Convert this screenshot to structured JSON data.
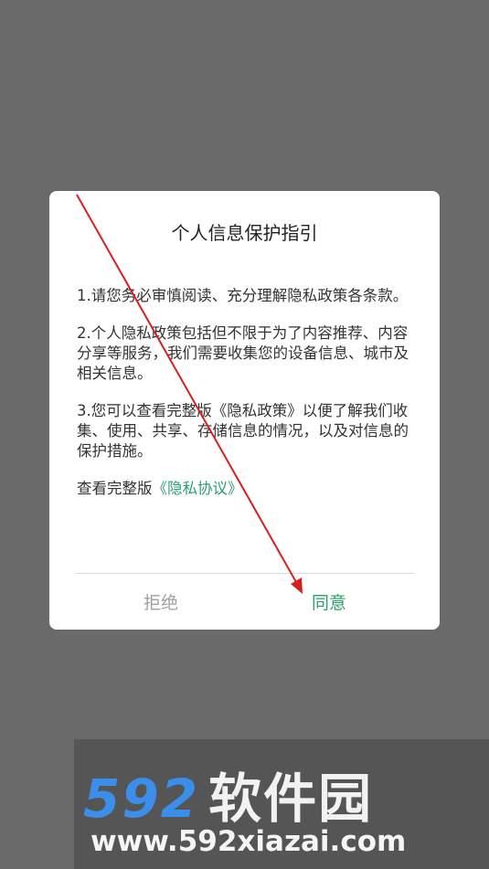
{
  "dialog": {
    "title": "个人信息保护指引",
    "paragraphs": [
      "1.请您务必审慎阅读、充分理解隐私政策各条款。",
      "2.个人隐私政策包括但不限于为了内容推荐、内容分享等服务，我们需要收集您的设备信息、城市及相关信息。",
      "3.您可以查看完整版《隐私政策》以便了解我们收集、使用、共享、存储信息的情况，以及对信息的保护措施。"
    ],
    "view_full_prefix": "查看完整版",
    "view_full_link": "《隐私协议》",
    "reject_label": "拒绝",
    "agree_label": "同意"
  },
  "watermark": {
    "brand_number": "592",
    "brand_text": "软件园",
    "url": "www.592xiazai.com"
  },
  "colors": {
    "accent": "#2aa06a",
    "overlay": "#6a6a6a",
    "annotation_arrow": "#d62020",
    "watermark_blue": "#3b8eea"
  }
}
